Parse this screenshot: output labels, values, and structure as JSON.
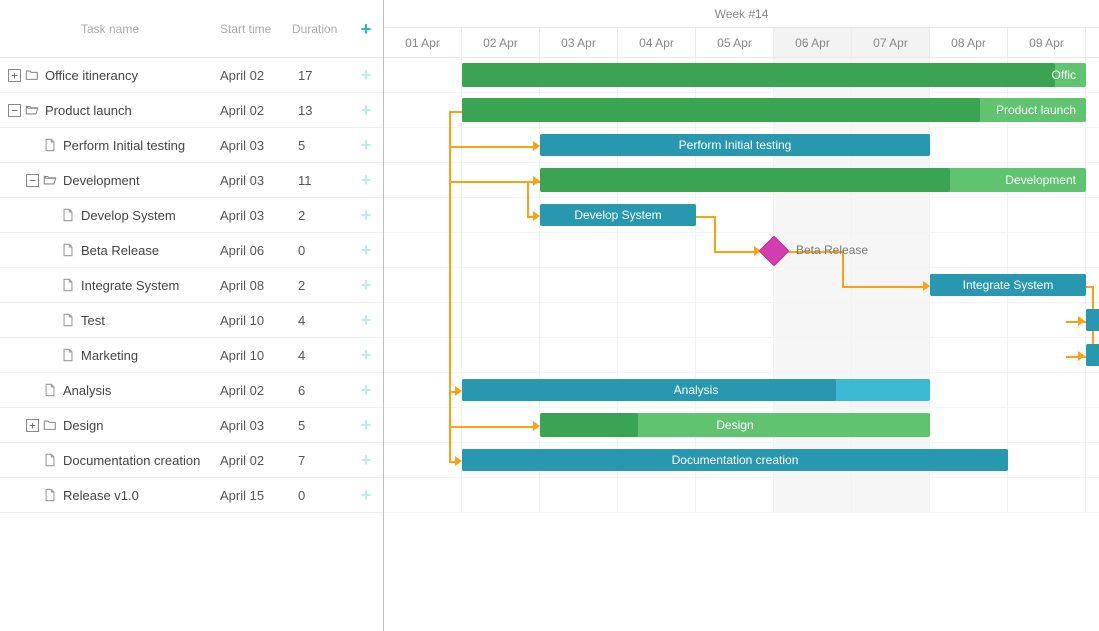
{
  "header": {
    "task_name": "Task name",
    "start_time": "Start time",
    "duration": "Duration",
    "week_label": "Week #14"
  },
  "days": [
    {
      "label": "01 Apr",
      "weekend": false
    },
    {
      "label": "02 Apr",
      "weekend": false
    },
    {
      "label": "03 Apr",
      "weekend": false
    },
    {
      "label": "04 Apr",
      "weekend": false
    },
    {
      "label": "05 Apr",
      "weekend": false
    },
    {
      "label": "06 Apr",
      "weekend": true
    },
    {
      "label": "07 Apr",
      "weekend": true
    },
    {
      "label": "08 Apr",
      "weekend": false
    },
    {
      "label": "09 Apr",
      "weekend": false
    }
  ],
  "tasks": [
    {
      "id": 1,
      "name": "Office itinerancy",
      "start": "April 02",
      "duration": 17,
      "indent": 0,
      "expander": "plus",
      "icon": "folder",
      "type": "parent",
      "bar_start": 1,
      "bar_len": 8,
      "progress": 0.95,
      "bar_label": "Offic"
    },
    {
      "id": 2,
      "name": "Product launch",
      "start": "April 02",
      "duration": 13,
      "indent": 0,
      "expander": "minus",
      "icon": "folder-open",
      "type": "parent",
      "bar_start": 1,
      "bar_len": 8,
      "progress": 0.83,
      "bar_label": "Product launch"
    },
    {
      "id": 3,
      "name": "Perform Initial testing",
      "start": "April 03",
      "duration": 5,
      "indent": 1,
      "expander": null,
      "icon": "file",
      "type": "task",
      "bar_start": 2,
      "bar_len": 5,
      "progress": 1.0,
      "bar_label": "Perform Initial testing"
    },
    {
      "id": 4,
      "name": "Development",
      "start": "April 03",
      "duration": 11,
      "indent": 1,
      "expander": "minus",
      "icon": "folder-open",
      "type": "parent",
      "bar_start": 2,
      "bar_len": 7,
      "progress": 0.75,
      "bar_label": "Development"
    },
    {
      "id": 5,
      "name": "Develop System",
      "start": "April 03",
      "duration": 2,
      "indent": 2,
      "expander": null,
      "icon": "file",
      "type": "task",
      "bar_start": 2,
      "bar_len": 2,
      "progress": 1.0,
      "bar_label": "Develop System"
    },
    {
      "id": 6,
      "name": "Beta Release",
      "start": "April 06",
      "duration": 0,
      "indent": 2,
      "expander": null,
      "icon": "file",
      "type": "milestone",
      "bar_start": 5,
      "bar_label": "Beta Release"
    },
    {
      "id": 7,
      "name": "Integrate System",
      "start": "April 08",
      "duration": 2,
      "indent": 2,
      "expander": null,
      "icon": "file",
      "type": "task",
      "bar_start": 7,
      "bar_len": 2,
      "progress": 1.0,
      "bar_label": "Integrate System"
    },
    {
      "id": 8,
      "name": "Test",
      "start": "April 10",
      "duration": 4,
      "indent": 2,
      "expander": null,
      "icon": "file",
      "type": "task",
      "bar_start": 9,
      "bar_len": 0.18,
      "progress": 1.0
    },
    {
      "id": 9,
      "name": "Marketing",
      "start": "April 10",
      "duration": 4,
      "indent": 2,
      "expander": null,
      "icon": "file",
      "type": "task",
      "bar_start": 9,
      "bar_len": 0.18,
      "progress": 1.0
    },
    {
      "id": 10,
      "name": "Analysis",
      "start": "April 02",
      "duration": 6,
      "indent": 1,
      "expander": null,
      "icon": "file",
      "type": "task",
      "bar_start": 1,
      "bar_len": 6,
      "progress": 0.8,
      "bar_label": "Analysis"
    },
    {
      "id": 11,
      "name": "Design",
      "start": "April 03",
      "duration": 5,
      "indent": 1,
      "expander": "plus",
      "icon": "folder",
      "type": "parent",
      "bar_start": 2,
      "bar_len": 5,
      "progress": 0.25,
      "bar_label": "Design"
    },
    {
      "id": 12,
      "name": "Documentation creation",
      "start": "April 02",
      "duration": 7,
      "indent": 1,
      "expander": null,
      "icon": "file",
      "type": "task",
      "bar_start": 1,
      "bar_len": 7,
      "progress": 1.0,
      "bar_label": "Documentation creation"
    },
    {
      "id": 13,
      "name": "Release v1.0",
      "start": "April 15",
      "duration": 0,
      "indent": 1,
      "expander": null,
      "icon": "file",
      "type": "offscreen"
    }
  ],
  "colors": {
    "parent_bg": "#5fc36f",
    "parent_prog": "#3ba453",
    "task_bg": "#3db9d3",
    "task_prog": "#2898b0",
    "milestone": "#d33daf",
    "link": "#ffa011",
    "accent": "#13c5b8"
  },
  "chart_data": {
    "type": "gantt",
    "time_unit": "day",
    "start_date": "01 Apr",
    "columns_shown": [
      "01 Apr",
      "02 Apr",
      "03 Apr",
      "04 Apr",
      "05 Apr",
      "06 Apr",
      "07 Apr",
      "08 Apr",
      "09 Apr"
    ],
    "weekend_columns": [
      "06 Apr",
      "07 Apr"
    ],
    "series": [
      {
        "name": "Office itinerancy",
        "type": "group",
        "start": "02 Apr",
        "duration_days": 17,
        "progress": 0.95
      },
      {
        "name": "Product launch",
        "type": "group",
        "start": "02 Apr",
        "duration_days": 13,
        "progress": 0.83,
        "children": [
          {
            "name": "Perform Initial testing",
            "type": "task",
            "start": "03 Apr",
            "duration_days": 5,
            "progress": 1.0
          },
          {
            "name": "Development",
            "type": "group",
            "start": "03 Apr",
            "duration_days": 11,
            "progress": 0.75,
            "children": [
              {
                "name": "Develop System",
                "type": "task",
                "start": "03 Apr",
                "duration_days": 2,
                "progress": 1.0
              },
              {
                "name": "Beta Release",
                "type": "milestone",
                "start": "06 Apr",
                "duration_days": 0
              },
              {
                "name": "Integrate System",
                "type": "task",
                "start": "08 Apr",
                "duration_days": 2,
                "progress": 1.0
              },
              {
                "name": "Test",
                "type": "task",
                "start": "10 Apr",
                "duration_days": 4
              },
              {
                "name": "Marketing",
                "type": "task",
                "start": "10 Apr",
                "duration_days": 4
              }
            ]
          },
          {
            "name": "Analysis",
            "type": "task",
            "start": "02 Apr",
            "duration_days": 6,
            "progress": 0.8
          },
          {
            "name": "Design",
            "type": "group",
            "start": "03 Apr",
            "duration_days": 5,
            "progress": 0.25
          },
          {
            "name": "Documentation creation",
            "type": "task",
            "start": "02 Apr",
            "duration_days": 7,
            "progress": 1.0
          },
          {
            "name": "Release v1.0",
            "type": "milestone",
            "start": "15 Apr",
            "duration_days": 0
          }
        ]
      }
    ],
    "dependencies": [
      {
        "from": "Product launch",
        "to": "Perform Initial testing",
        "type": "start-to-start"
      },
      {
        "from": "Product launch",
        "to": "Development",
        "type": "start-to-start"
      },
      {
        "from": "Develop System",
        "to": "Beta Release",
        "type": "finish-to-start"
      },
      {
        "from": "Beta Release",
        "to": "Integrate System",
        "type": "finish-to-start"
      },
      {
        "from": "Integrate System",
        "to": "Test",
        "type": "finish-to-start"
      },
      {
        "from": "Integrate System",
        "to": "Marketing",
        "type": "finish-to-start"
      },
      {
        "from": "Product launch",
        "to": "Analysis",
        "type": "start-to-start"
      },
      {
        "from": "Product launch",
        "to": "Design",
        "type": "start-to-start"
      },
      {
        "from": "Product launch",
        "to": "Documentation creation",
        "type": "start-to-start"
      }
    ]
  }
}
